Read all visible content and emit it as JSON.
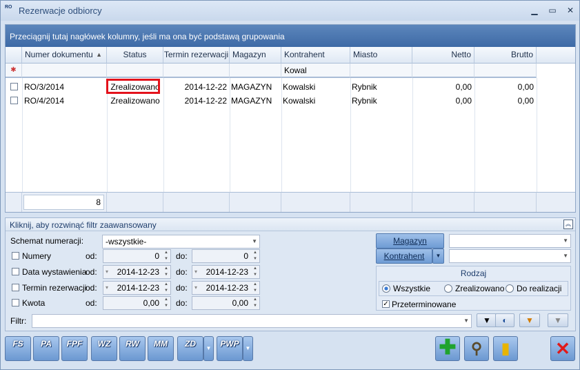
{
  "window": {
    "title": "Rezerwacje odbiorcy",
    "icon_text": "RO"
  },
  "grid": {
    "group_hint": "Przeciągnij tutaj nagłówek kolumny, jeśli ma ona być podstawą grupowania",
    "columns": [
      "Numer dokumentu",
      "Status",
      "Termin rezerwacji",
      "Magazyn",
      "Kontrahent",
      "Miasto",
      "Netto",
      "Brutto"
    ],
    "sort_indicator": "▲",
    "filter_row": {
      "kontrahent": "Kowal"
    },
    "rows": [
      {
        "numer": "RO/3/2014",
        "status": "Zrealizowano",
        "termin": "2014-12-22",
        "magazyn": "MAGAZYN",
        "kontrahent": "Kowalski",
        "miasto": "Rybnik",
        "netto": "0,00",
        "brutto": "0,00"
      },
      {
        "numer": "RO/4/2014",
        "status": "Zrealizowano",
        "termin": "2014-12-22",
        "magazyn": "MAGAZYN",
        "kontrahent": "Kowalski",
        "miasto": "Rybnik",
        "netto": "0,00",
        "brutto": "0,00"
      }
    ],
    "footer_count": "8"
  },
  "filter": {
    "header": "Kliknij, aby rozwinąć filtr zaawansowany",
    "schemat_label": "Schemat numeracji:",
    "schemat_value": "-wszystkie-",
    "numery": {
      "label": "Numery",
      "od_label": "od:",
      "do_label": "do:",
      "od": "0",
      "do": "0"
    },
    "data_wyst": {
      "label": "Data wystawienia",
      "od_label": "od:",
      "do_label": "do:",
      "od": "2014-12-23",
      "do": "2014-12-23"
    },
    "termin": {
      "label": "Termin rezerwacji",
      "od_label": "od:",
      "do_label": "do:",
      "od": "2014-12-23",
      "do": "2014-12-23"
    },
    "kwota": {
      "label": "Kwota",
      "od_label": "od:",
      "do_label": "do:",
      "od": "0,00",
      "do": "0,00"
    },
    "magazyn_btn": "Magazyn",
    "kontrahent_btn": "Kontrahent",
    "rodzaj_title": "Rodzaj",
    "rodzaj_options": [
      "Wszystkie",
      "Zrealizowano",
      "Do realizacji"
    ],
    "przeterminowane": "Przeterminowane",
    "filtr_label": "Filtr:"
  },
  "toolbar": {
    "buttons": [
      "FS",
      "PA",
      "FPF",
      "WZ",
      "RW",
      "MM",
      "ZD",
      "PWP"
    ]
  }
}
